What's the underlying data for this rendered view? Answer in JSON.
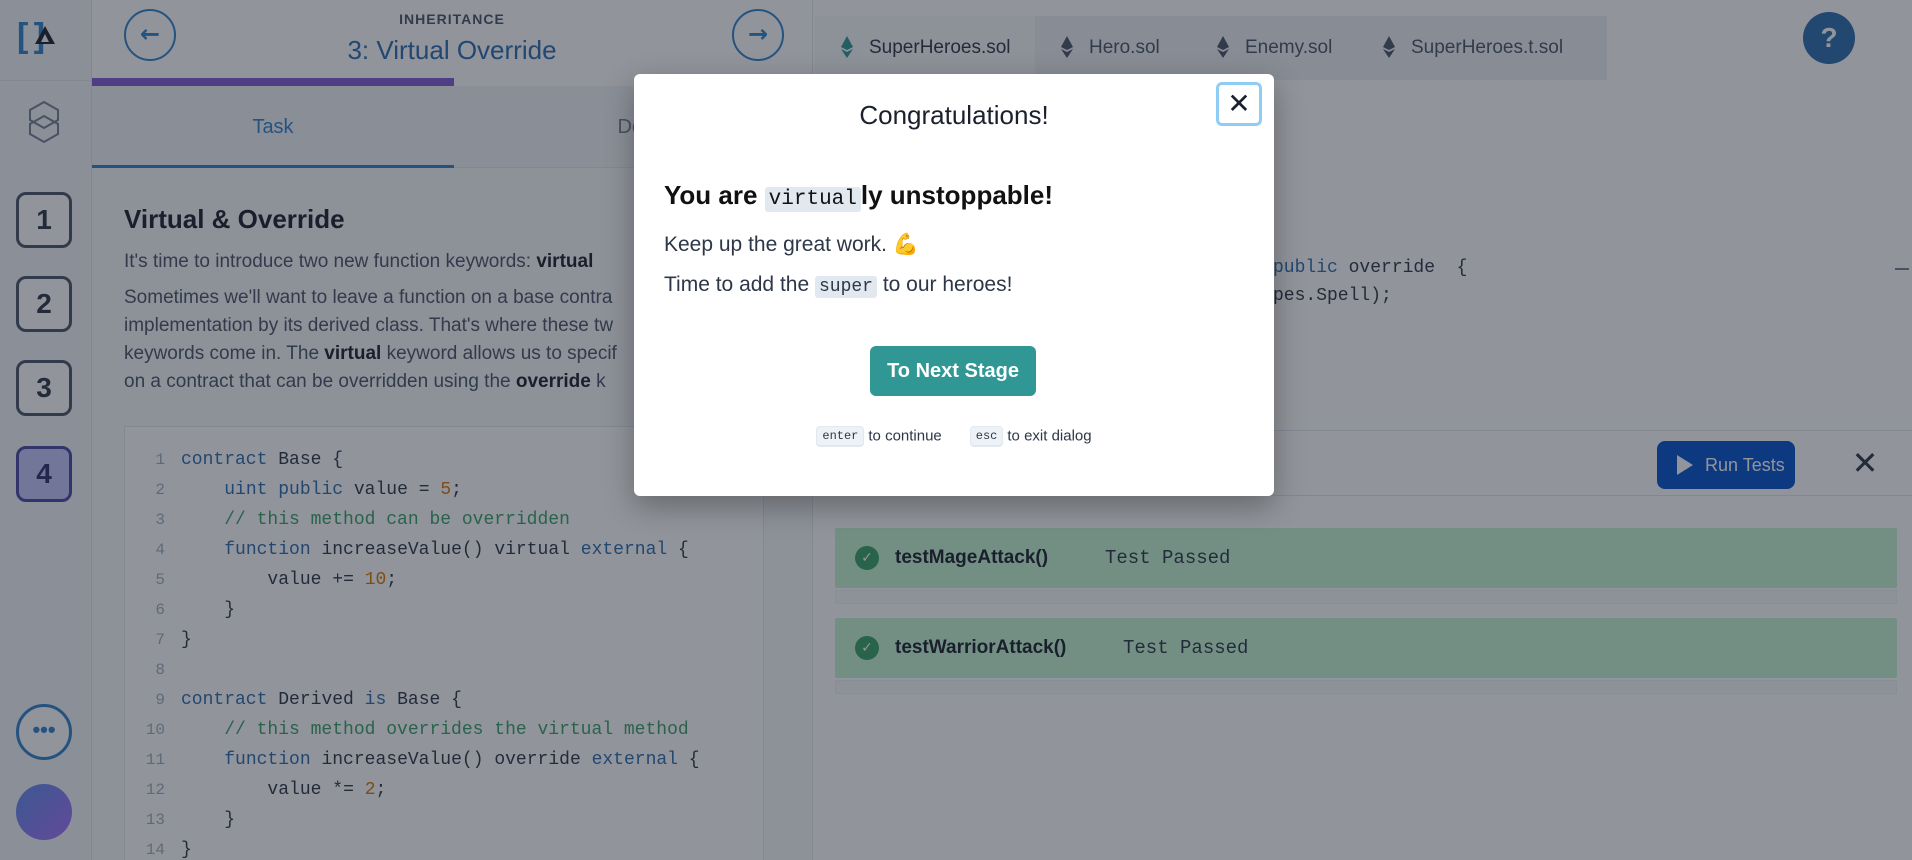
{
  "rail": {
    "logo_text": "[ ]",
    "stages": [
      "1",
      "2",
      "3",
      "4"
    ],
    "active_stage": "4",
    "more_label": "•••"
  },
  "header": {
    "section": "INHERITANCE",
    "title": "3: Virtual Override",
    "prev_icon": "arrow-left-icon",
    "next_icon": "arrow-right-icon",
    "progress": 0.5
  },
  "task": {
    "tabs": [
      "Task",
      "Det"
    ],
    "heading": "Virtual & Override",
    "para1_prefix": "It's time to introduce two new function keywords: ",
    "para1_bold": "virtual",
    "para2_line1": "Sometimes we'll want to leave a function on a base contra",
    "para2_line2": "implementation by its derived class. That's where these tw",
    "para2_line3_prefix": "keywords come in. The ",
    "para2_line3_bold": "virtual",
    "para2_line3_suffix": " keyword allows us to specif",
    "para2_line4_prefix": "on a contract that can be overridden using the ",
    "para2_line4_bold": "override",
    "para2_line4_suffix": " k",
    "code_lines": [
      "contract Base {",
      "    uint public value = 5;",
      "    // this method can be overridden",
      "    function increaseValue() virtual external {",
      "        value += 10;",
      "    }",
      "}",
      "",
      "contract Derived is Base {",
      "    // this method overrides the virtual method",
      "    function increaseValue() override external {",
      "        value *= 2;",
      "    }",
      "}"
    ]
  },
  "editor": {
    "file_tabs": [
      "SuperHeroes.sol",
      "Hero.sol",
      "Enemy.sol",
      "SuperHeroes.t.sol"
    ],
    "active_file": "SuperHeroes.sol",
    "help_label": "?",
    "code_line1_kw": "public",
    "code_line1_rest": " override  {",
    "code_line2": "pes.Spell);",
    "run_tests_label": "Run Tests",
    "close_label": "✕",
    "tests": [
      {
        "name": "testMageAttack()",
        "status": "Test Passed"
      },
      {
        "name": "testWarriorAttack()",
        "status": "Test Passed"
      }
    ]
  },
  "modal": {
    "title": "Congratulations!",
    "close_label": "✕",
    "headline_prefix": "You are ",
    "headline_code": "virtual",
    "headline_suffix": "ly unstoppable!",
    "line1": "Keep up the great work. 💪",
    "line2_prefix": "Time to add the ",
    "line2_code": "super",
    "line2_suffix": " to our heroes!",
    "next_button": "To Next Stage",
    "hint_enter_key": "enter",
    "hint_enter_text": "to continue",
    "hint_esc_key": "esc",
    "hint_esc_text": "to exit dialog"
  }
}
